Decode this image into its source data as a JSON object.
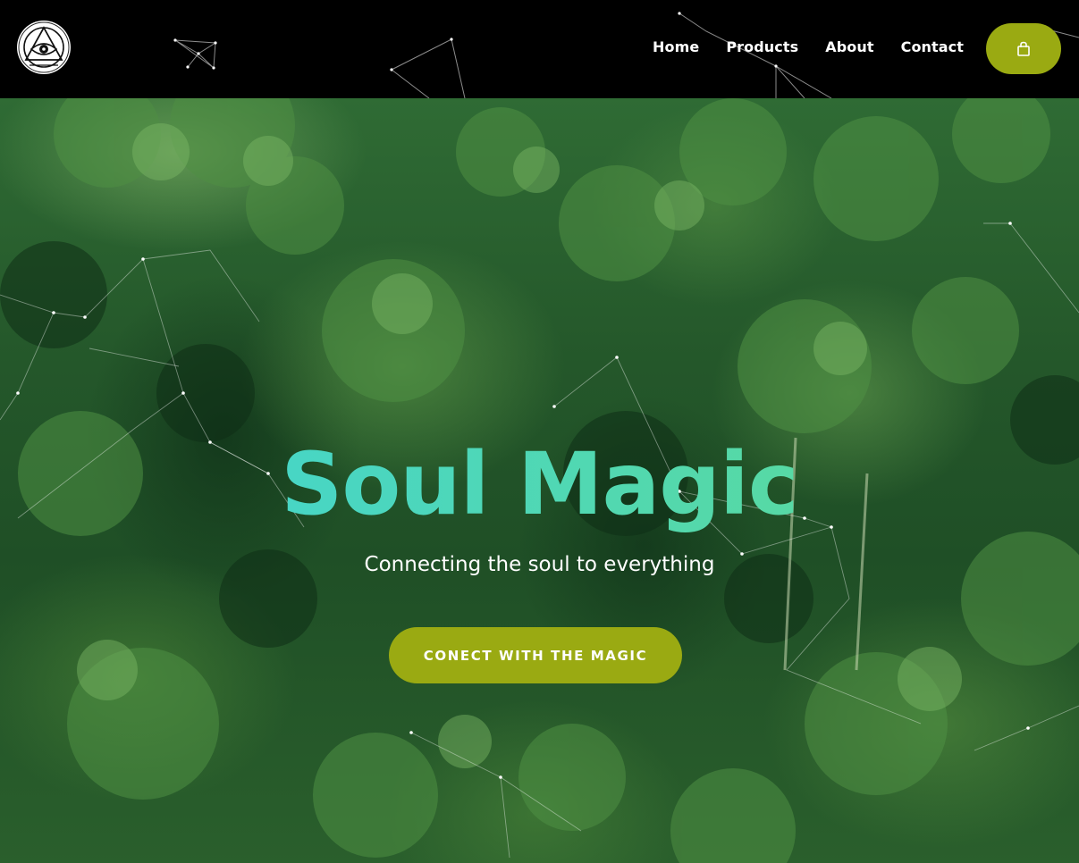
{
  "brand": {
    "logo_icon": "eye-in-triangle-icon"
  },
  "nav": {
    "items": [
      {
        "label": "Home"
      },
      {
        "label": "Products"
      },
      {
        "label": "About"
      },
      {
        "label": "Contact"
      }
    ]
  },
  "cart": {
    "icon": "shopping-bag-icon"
  },
  "hero": {
    "title": "Soul Magic",
    "subtitle": "Connecting the soul to everything",
    "cta_label": "CONECT WITH THE MAGIC",
    "background": "rainforest-canopy-photo"
  },
  "colors": {
    "header_bg": "#000000",
    "accent": "#9aaa12",
    "title_gradient_start": "#3fd4d6",
    "title_gradient_end": "#5fdb93",
    "text": "#ffffff"
  }
}
